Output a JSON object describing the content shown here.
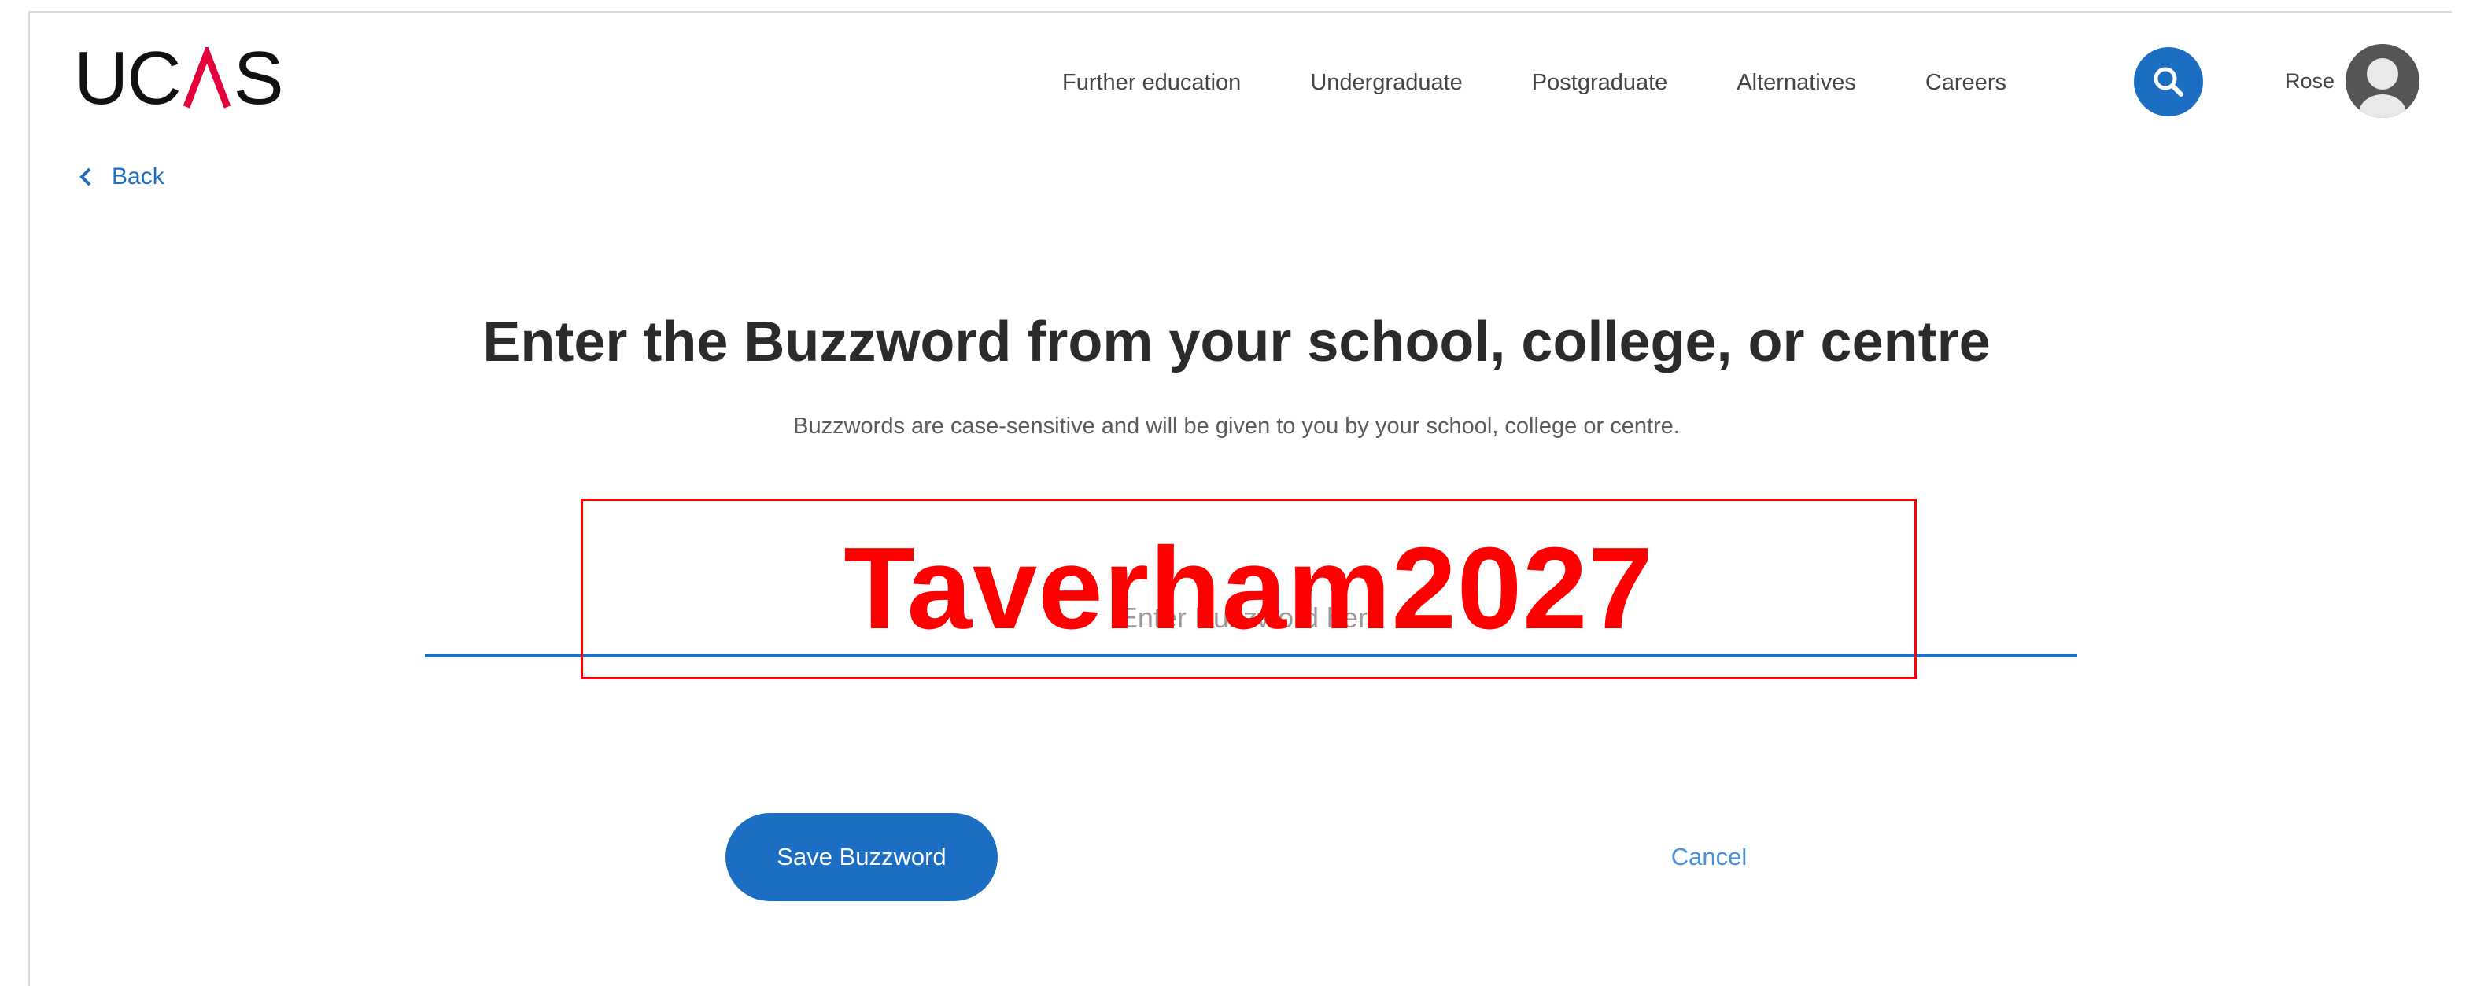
{
  "header": {
    "logo_text_left": "UC",
    "logo_text_right": "S",
    "nav": [
      {
        "label": "Further education"
      },
      {
        "label": "Undergraduate"
      },
      {
        "label": "Postgraduate"
      },
      {
        "label": "Alternatives"
      },
      {
        "label": "Careers"
      }
    ],
    "search_icon": "search-icon",
    "user_name": "Rose",
    "avatar_icon": "user-avatar-icon"
  },
  "back": {
    "label": "Back",
    "icon": "chevron-left-icon"
  },
  "main": {
    "heading": "Enter the Buzzword from your school, college, or centre",
    "subtitle": "Buzzwords are case-sensitive and will be given to you by your school, college or centre.",
    "input_placeholder": "Enter Buzzword here",
    "overlay_text": "Taverham2027",
    "save_label": "Save Buzzword",
    "cancel_label": "Cancel"
  },
  "colors": {
    "accent": "#1b6ec2",
    "logo_accent": "#e4003b",
    "overlay": "#ff0000",
    "text": "#2b2b2b"
  }
}
